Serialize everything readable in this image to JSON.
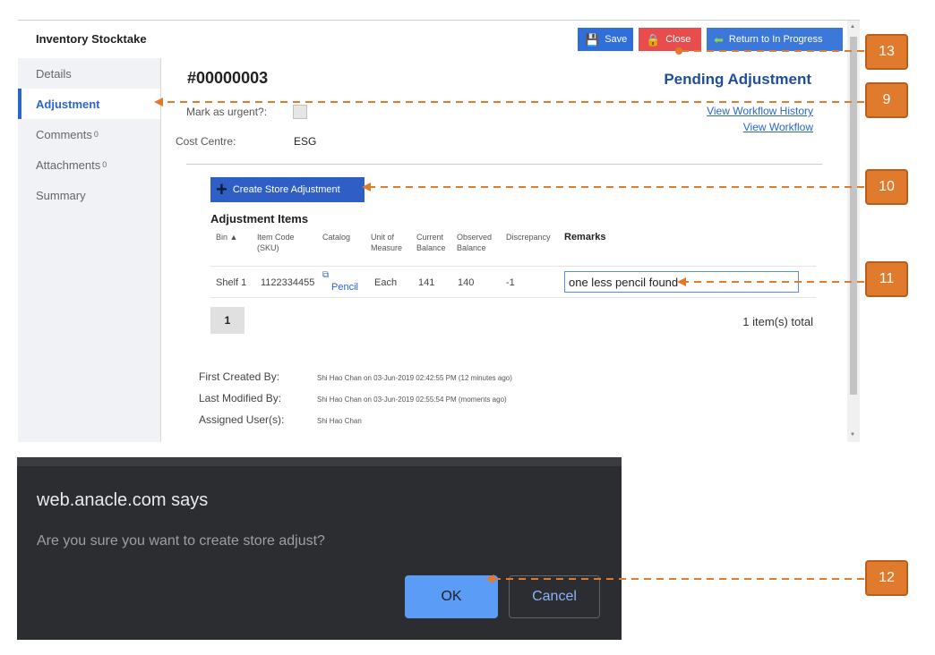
{
  "app": {
    "title": "Inventory Stocktake",
    "toolbar": {
      "save": "Save",
      "close": "Close",
      "return": "Return to In Progress"
    },
    "sidebar": [
      {
        "label": "Details",
        "count": ""
      },
      {
        "label": "Adjustment",
        "count": "",
        "active": true
      },
      {
        "label": "Comments",
        "count": "0"
      },
      {
        "label": "Attachments",
        "count": "0"
      },
      {
        "label": "Summary",
        "count": ""
      }
    ],
    "record_no": "#00000003",
    "status": "Pending Adjustment",
    "links": {
      "history": "View Workflow History",
      "workflow": "View Workflow"
    },
    "urgent_label": "Mark as urgent?:",
    "cost_centre_label": "Cost Centre:",
    "cost_centre_value": "ESG",
    "create_button": "Create Store Adjustment",
    "items_title": "Adjustment Items",
    "columns": {
      "bin": "Bin ▲",
      "item_code": "Item Code (SKU)",
      "catalog": "Catalog",
      "uom": "Unit of Measure",
      "current": "Current Balance",
      "observed": "Observed Balance",
      "discrepancy": "Discrepancy",
      "remarks": "Remarks"
    },
    "row": {
      "bin": "Shelf 1",
      "item_code": "1122334455",
      "catalog": "Pencil",
      "uom": "Each",
      "current": "141",
      "observed": "140",
      "discrepancy": "-1",
      "remarks": "one less pencil found"
    },
    "page": "1",
    "total": "1 item(s) total",
    "meta": {
      "created_label": "First Created By:",
      "created_value": "Shi Hao Chan on 03-Jun-2019 02:42:55 PM (12 minutes ago)",
      "modified_label": "Last Modified By:",
      "modified_value": "Shi Hao Chan on 03-Jun-2019 02:55:54 PM (moments ago)",
      "assigned_label": "Assigned User(s):",
      "assigned_value": "Shi Hao Chan"
    }
  },
  "dialog": {
    "title": "web.anacle.com says",
    "message": "Are you sure you want to create store adjust?",
    "ok": "OK",
    "cancel": "Cancel"
  },
  "callouts": [
    "13",
    "9",
    "10",
    "11",
    "12"
  ],
  "colors": {
    "accent": "#2f6edb",
    "close": "#e84c4c",
    "callout": "#e07b2d",
    "dialog_bg": "#2b2d30"
  }
}
